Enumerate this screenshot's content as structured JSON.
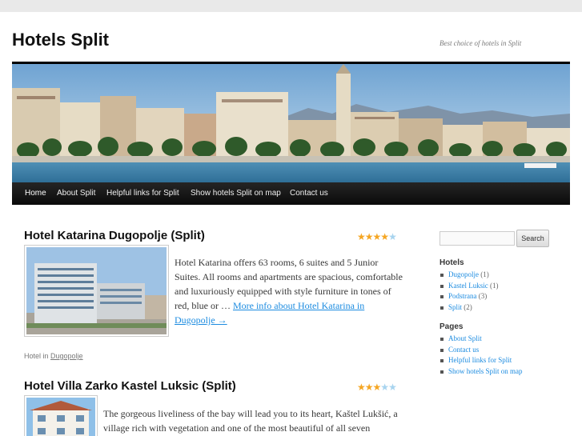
{
  "site": {
    "title": "Hotels Split",
    "description": "Best choice of hotels in Split"
  },
  "nav": {
    "items": [
      "Home",
      "About Split",
      "Helpful links for Split",
      "Show hotels Split on map",
      "Contact us"
    ]
  },
  "posts": [
    {
      "title": "Hotel Katarina Dugopolje (Split)",
      "rating": 4,
      "rating_max": 5,
      "excerpt": "Hotel Katarina offers 63 rooms, 6 suites and 5 Junior Suites. All rooms and apartments are spacious, comfortable and luxuriously equipped with style furniture in tones of red, blue or …",
      "more_link": "More info about Hotel Katarina in Dugopolje →",
      "caption_prefix": "Hotel in",
      "caption_link": "Dugopolje"
    },
    {
      "title": "Hotel Villa Zarko Kastel Luksic (Split)",
      "rating": 3,
      "rating_max": 5,
      "excerpt": "The gorgeous liveliness of the bay will lead you to its heart, Kaštel Lukšić, a village rich with vegetation and one of the most beautiful of all seven picturesque Kaštela. …"
    }
  ],
  "sidebar": {
    "search_button": "Search",
    "search_placeholder": "",
    "hotels_title": "Hotels",
    "hotels": [
      {
        "label": "Dugopolje",
        "count": "(1)"
      },
      {
        "label": "Kastel Luksic",
        "count": "(1)"
      },
      {
        "label": "Podstrana",
        "count": "(3)"
      },
      {
        "label": "Split",
        "count": "(2)"
      }
    ],
    "pages_title": "Pages",
    "pages": [
      "About Split",
      "Contact us",
      "Helpful links for Split",
      "Show hotels Split on map"
    ]
  },
  "icons": {
    "star_filled": "star-icon",
    "star_empty": "star-empty-icon"
  },
  "colors": {
    "link": "#1b8be0",
    "star": "#f5a623",
    "star_empty": "#a8d4ef",
    "nav_bg": "#111111"
  }
}
